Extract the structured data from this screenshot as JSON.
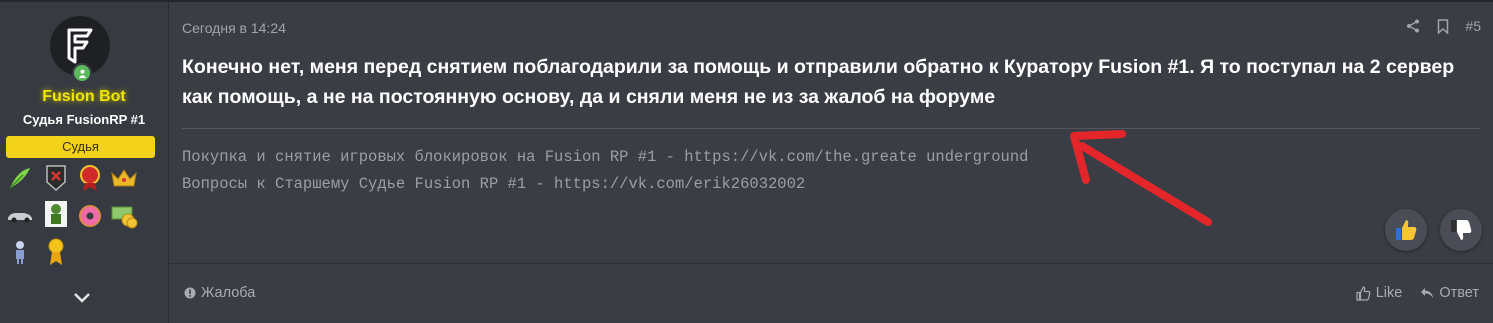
{
  "user": {
    "name": "Fusion Bot",
    "title": "Судья FusionRP #1",
    "banner": "Судья",
    "name_color": "#f0e600",
    "banner_color": "#f3d21a"
  },
  "awards": [
    "feather-award-icon",
    "dark-badge-award-icon",
    "red-medal-award-icon",
    "crown-award-icon",
    "car-award-icon",
    "green-figure-award-icon",
    "donut-award-icon",
    "money-award-icon",
    "figure-award-icon",
    "gold-medal-award-icon"
  ],
  "post": {
    "date": "Сегодня в 14:24",
    "number": "#5",
    "message": "Конечно нет, меня перед снятием поблагодарили за помощь и отправили обратно к Куратору Fusion #1. Я то поступал на 2 сервер как помощь, а не на постоянную основу, да и сняли меня не из за жалоб на форуме",
    "signature": [
      "Покупка и снятие игровых блокировок на Fusion RP #1 - https://vk.com/the.greate   underground",
      "Вопросы к Старшему Судье Fusion RP #1 - https://vk.com/erik26032002"
    ]
  },
  "footer": {
    "report": "Жалоба",
    "like": "Like",
    "reply": "Ответ"
  },
  "colors": {
    "background": "#3b3d44",
    "sidebar": "#373a40",
    "annotation_arrow": "#e4262b"
  }
}
